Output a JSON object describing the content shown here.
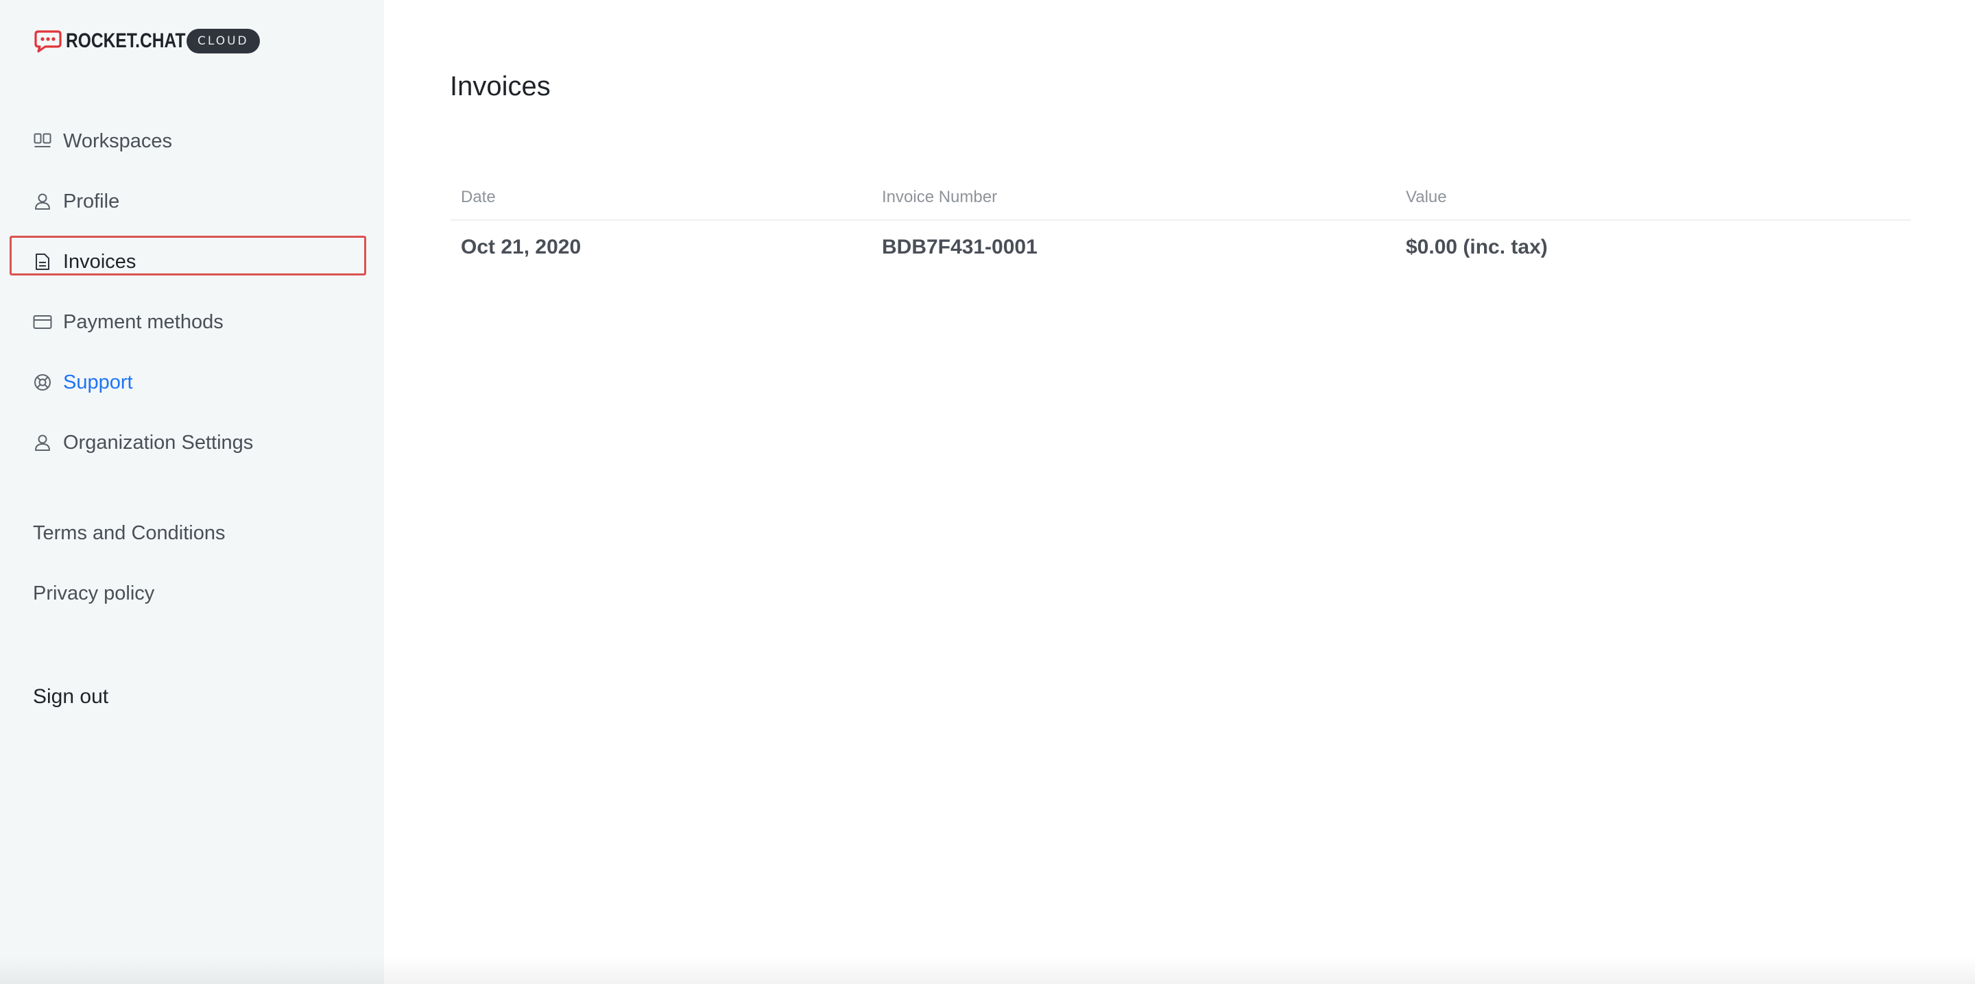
{
  "brand": {
    "name": "ROCKET.CHAT",
    "badge": "CLOUD",
    "logo_color": "#e0363b"
  },
  "sidebar": {
    "items": [
      {
        "label": "Workspaces",
        "icon": "workspaces-icon"
      },
      {
        "label": "Profile",
        "icon": "user-icon"
      },
      {
        "label": "Invoices",
        "icon": "document-icon",
        "active": true
      },
      {
        "label": "Payment methods",
        "icon": "credit-card-icon"
      },
      {
        "label": "Support",
        "icon": "lifebuoy-icon"
      },
      {
        "label": "Organization Settings",
        "icon": "user-icon"
      }
    ],
    "links": [
      {
        "label": "Terms and Conditions"
      },
      {
        "label": "Privacy policy"
      }
    ],
    "signout_label": "Sign out",
    "support_color": "#1d74f5"
  },
  "main": {
    "title": "Invoices",
    "table": {
      "columns": [
        "Date",
        "Invoice Number",
        "Value"
      ],
      "rows": [
        [
          "Oct 21, 2020",
          "BDB7F431-0001",
          "$0.00 (inc. tax)"
        ]
      ]
    }
  }
}
